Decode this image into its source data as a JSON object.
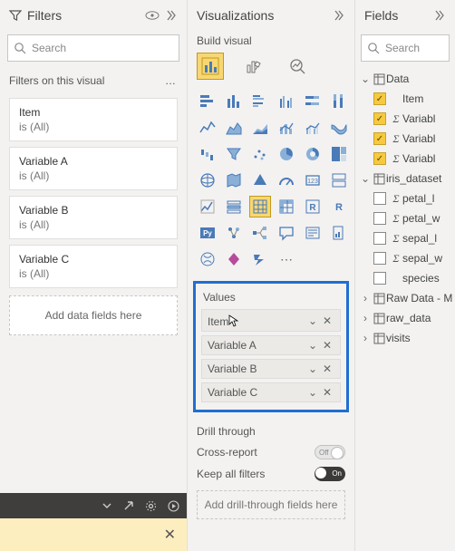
{
  "filters": {
    "title": "Filters",
    "search_placeholder": "Search",
    "section_title": "Filters on this visual",
    "cards": [
      {
        "name": "Item",
        "status": "is (All)"
      },
      {
        "name": "Variable A",
        "status": "is (All)"
      },
      {
        "name": "Variable B",
        "status": "is (All)"
      },
      {
        "name": "Variable C",
        "status": "is (All)"
      }
    ],
    "add_label": "Add data fields here"
  },
  "visuals": {
    "title": "Visualizations",
    "subtitle": "Build visual",
    "values_label": "Values",
    "value_fields": [
      "Item",
      "Variable A",
      "Variable B",
      "Variable C"
    ],
    "drill_label": "Drill through",
    "cross_report_label": "Cross-report",
    "cross_report_state": "Off",
    "keep_filters_label": "Keep all filters",
    "keep_filters_state": "On",
    "add_drill_label": "Add drill-through fields here",
    "gallery_icons": [
      "stacked-bar",
      "clustered-bar",
      "stacked-column",
      "clustered-column",
      "stacked-bar-100",
      "clustered-column-100",
      "line",
      "area",
      "stacked-area",
      "line-stacked",
      "line-clustered",
      "ribbon",
      "waterfall",
      "funnel",
      "scatter",
      "pie",
      "donut",
      "treemap",
      "map",
      "filled-map",
      "azure-map",
      "gauge",
      "card",
      "multi-row",
      "kpi",
      "slicer",
      "table",
      "matrix",
      "r-visual",
      "r-script",
      "python",
      "key-influencers",
      "decomposition",
      "qa",
      "narrative",
      "paginated",
      "arcgis",
      "power-apps",
      "power-automate",
      "more"
    ]
  },
  "fields": {
    "title": "Fields",
    "search_placeholder": "Search",
    "tables": [
      {
        "name": "Data",
        "expanded": true,
        "fields": [
          {
            "name": "Item",
            "checked": true,
            "sigma": false
          },
          {
            "name": "Variable A",
            "checked": true,
            "sigma": true,
            "truncated": "Variabl"
          },
          {
            "name": "Variable B",
            "checked": true,
            "sigma": true,
            "truncated": "Variabl"
          },
          {
            "name": "Variable C",
            "checked": true,
            "sigma": true,
            "truncated": "Variabl"
          }
        ]
      },
      {
        "name": "iris_dataset",
        "expanded": true,
        "fields": [
          {
            "name": "petal_length",
            "checked": false,
            "sigma": true,
            "truncated": "petal_l"
          },
          {
            "name": "petal_width",
            "checked": false,
            "sigma": true,
            "truncated": "petal_w"
          },
          {
            "name": "sepal_length",
            "checked": false,
            "sigma": true,
            "truncated": "sepal_l"
          },
          {
            "name": "sepal_width",
            "checked": false,
            "sigma": true,
            "truncated": "sepal_w"
          },
          {
            "name": "species",
            "checked": false,
            "sigma": false,
            "truncated": "species"
          }
        ]
      },
      {
        "name": "Raw Data - M",
        "expanded": false
      },
      {
        "name": "raw_data",
        "expanded": false
      },
      {
        "name": "visits",
        "expanded": false
      }
    ]
  }
}
